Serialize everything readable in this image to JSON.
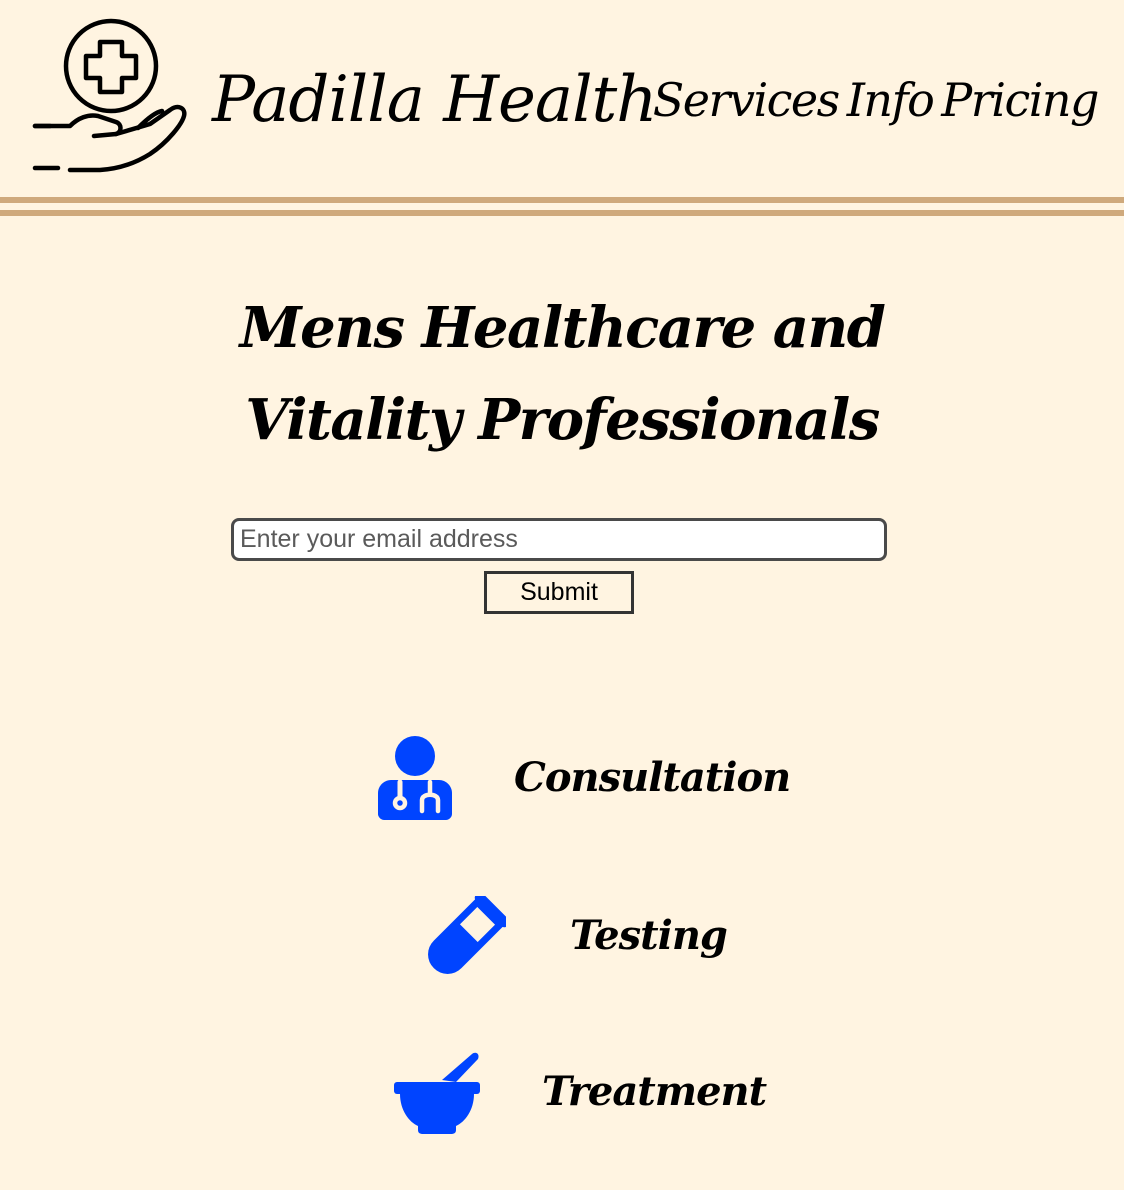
{
  "header": {
    "brand": "Padilla Health",
    "logo_icon": "hand-holding-medical-icon",
    "nav": [
      {
        "label": "Services"
      },
      {
        "label": "Info"
      },
      {
        "label": "Pricing"
      }
    ],
    "rule_color": "#cfa97c"
  },
  "main": {
    "headline": "Mens Healthcare and Vitality Professionals",
    "email": {
      "value": "",
      "placeholder": "Enter your email address"
    },
    "submit_label": "Submit"
  },
  "services": [
    {
      "label": "Consultation",
      "icon": "user-doctor-icon"
    },
    {
      "label": "Testing",
      "icon": "vial-icon"
    },
    {
      "label": "Treatment",
      "icon": "mortar-pestle-icon"
    }
  ],
  "colors": {
    "background": "#fff4e1",
    "icon_accent": "#0044ff",
    "text": "#000000"
  }
}
